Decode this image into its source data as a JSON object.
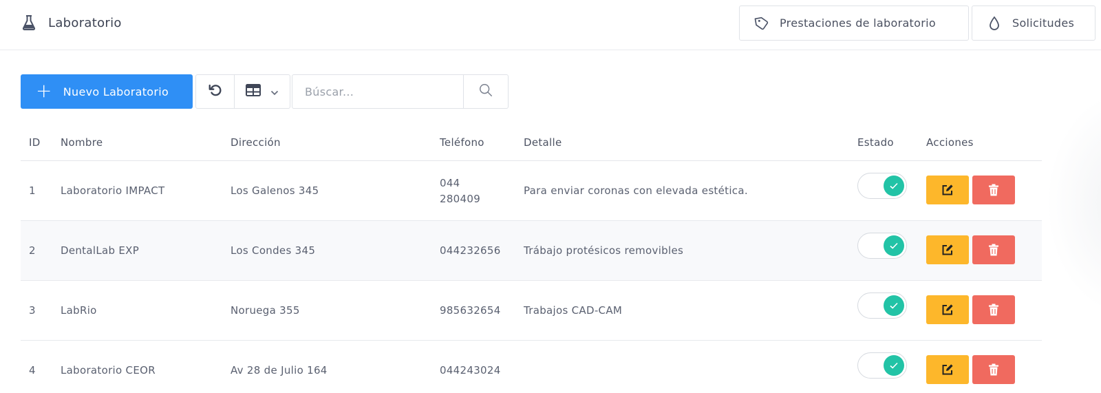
{
  "header": {
    "title": "Laboratorio",
    "buttons": {
      "prestaciones": "Prestaciones de laboratorio",
      "solicitudes": "Solicitudes"
    }
  },
  "toolbar": {
    "new_label": "Nuevo Laboratorio",
    "search_placeholder": "Búscar...",
    "search_value": ""
  },
  "table": {
    "columns": {
      "id": "ID",
      "nombre": "Nombre",
      "direccion": "Dirección",
      "telefono": "Teléfono",
      "detalle": "Detalle",
      "estado": "Estado",
      "acciones": "Acciones"
    },
    "rows": [
      {
        "id": "1",
        "nombre": "Laboratorio IMPACT",
        "direccion": "Los Galenos 345",
        "telefono": "044\n280409",
        "detalle": "Para enviar coronas con elevada estética.",
        "estado": true
      },
      {
        "id": "2",
        "nombre": "DentalLab EXP",
        "direccion": "Los Condes 345",
        "telefono": "044232656",
        "detalle": "Trábajo protésicos removibles",
        "estado": true
      },
      {
        "id": "3",
        "nombre": "LabRio",
        "direccion": "Noruega 355",
        "telefono": "985632654",
        "detalle": "Trabajos CAD-CAM",
        "estado": true
      },
      {
        "id": "4",
        "nombre": "Laboratorio CEOR",
        "direccion": "Av 28 de Julio 164",
        "telefono": "044243024",
        "detalle": "",
        "estado": true
      }
    ]
  },
  "colors": {
    "primary": "#2f8ff5",
    "toggle_on": "#22c3a6",
    "edit": "#fdb72b",
    "delete": "#f06a5f"
  },
  "icons": {
    "title": "flask-icon",
    "prestaciones": "tag-icon",
    "solicitudes": "drop-icon",
    "new": "plus-icon",
    "refresh": "refresh-icon",
    "columns": "table-columns-icon",
    "search": "search-icon",
    "edit": "edit-icon",
    "delete": "trash-icon",
    "toggle": "check-icon"
  }
}
